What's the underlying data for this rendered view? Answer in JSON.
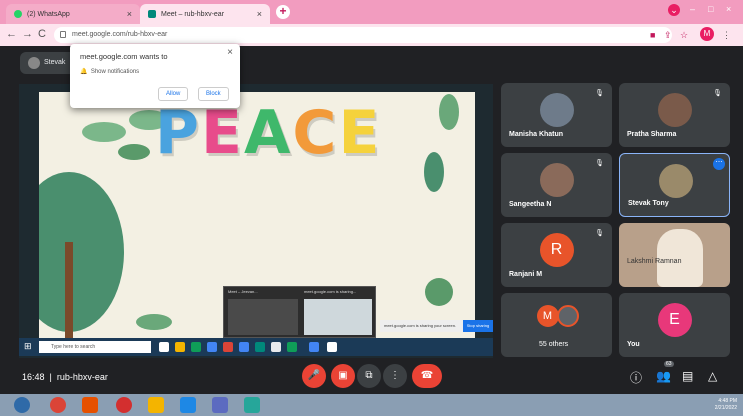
{
  "browser": {
    "tabs": [
      {
        "label": "(2) WhatsApp",
        "active": false
      },
      {
        "label": "Meet – rub-hbxv-ear",
        "active": true
      }
    ],
    "url": "meet.google.com/rub-hbxv-ear"
  },
  "notification": {
    "title": "meet.google.com wants to",
    "row": "Show notifications",
    "allow": "Allow",
    "block": "Block"
  },
  "presenter": {
    "label": "Stevak"
  },
  "slide": {
    "word": [
      "P",
      "E",
      "A",
      "C",
      "E"
    ],
    "colors": [
      "#4aa3df",
      "#e84c8b",
      "#3fb86b",
      "#f29a3a",
      "#f5d23c"
    ]
  },
  "taskbar_inner": {
    "search": "Type here to search"
  },
  "thumb": {
    "title1": "Meet – Jeevan...",
    "title2": "meet.google.com is sharing..."
  },
  "toast": {
    "text": "meet.google.com is sharing your screen.",
    "button": "Stop sharing"
  },
  "participants": [
    {
      "name": "Manisha Khatun",
      "type": "photo",
      "color": "#6e7b8a"
    },
    {
      "name": "Pratha Sharma",
      "type": "photo",
      "color": "#7a5a4a"
    },
    {
      "name": "Sangeetha N",
      "type": "photo",
      "color": "#8a6a5a"
    },
    {
      "name": "Stevak Tony",
      "type": "photo",
      "color": "#9a8a6a"
    },
    {
      "name": "Ranjani M",
      "type": "letter",
      "letter": "R",
      "color": "#e8542a"
    },
    {
      "name": "Lakshmi Ramnan",
      "type": "video",
      "color": "#b8a08a"
    },
    {
      "name": "55 others",
      "type": "group",
      "letter": "M",
      "color": "#e8542a"
    },
    {
      "name": "You",
      "type": "letter",
      "letter": "E",
      "color": "#e8387a"
    }
  ],
  "meeting": {
    "time": "16:48",
    "code": "rub-hbxv-ear"
  },
  "tray": {
    "time": "4:48 PM",
    "date": "2/21/2022"
  },
  "badge": "63"
}
